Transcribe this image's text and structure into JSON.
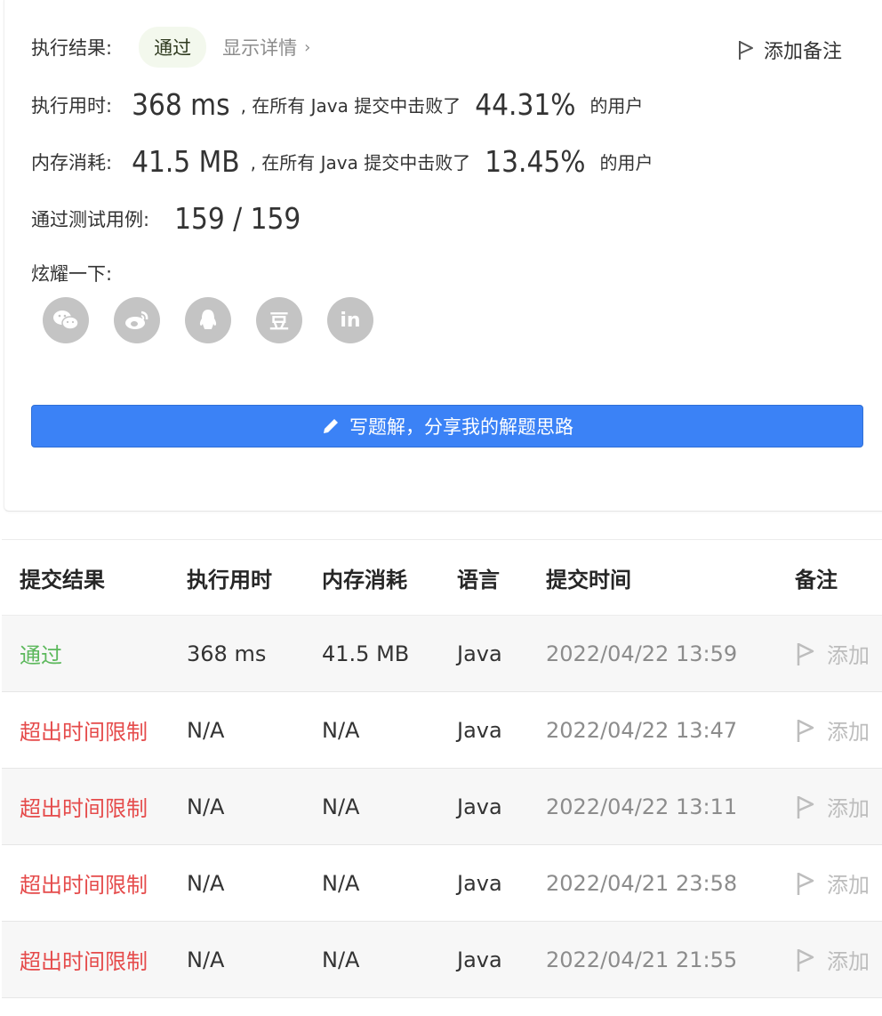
{
  "result": {
    "label": "执行结果:",
    "status": "通过",
    "detail": "显示详情",
    "add_note": "添加备注"
  },
  "runtime": {
    "label": "执行用时:",
    "value": "368 ms",
    "mid": ", 在所有 Java 提交中击败了",
    "percent": "44.31%",
    "suffix": "的用户"
  },
  "memory": {
    "label": "内存消耗:",
    "value": "41.5 MB",
    "mid": ", 在所有 Java 提交中击败了",
    "percent": "13.45%",
    "suffix": "的用户"
  },
  "tests": {
    "label": "通过测试用例:",
    "value": "159 / 159"
  },
  "share": {
    "label": "炫耀一下:",
    "icons": [
      "wechat-icon",
      "weibo-icon",
      "qq-icon",
      "douban-icon",
      "linkedin-icon"
    ],
    "douban_glyph": "豆",
    "linkedin_glyph": "in"
  },
  "write_button": "写题解，分享我的解题思路",
  "table": {
    "headers": [
      "提交结果",
      "执行用时",
      "内存消耗",
      "语言",
      "提交时间",
      "备注"
    ],
    "rows": [
      {
        "result": "通过",
        "time": "368 ms",
        "memory": "41.5 MB",
        "lang": "Java",
        "date": "2022/04/22 13:59",
        "note": "添加"
      },
      {
        "result": "超出时间限制",
        "time": "N/A",
        "memory": "N/A",
        "lang": "Java",
        "date": "2022/04/22 13:47",
        "note": "添加"
      },
      {
        "result": "超出时间限制",
        "time": "N/A",
        "memory": "N/A",
        "lang": "Java",
        "date": "2022/04/22 13:11",
        "note": "添加"
      },
      {
        "result": "超出时间限制",
        "time": "N/A",
        "memory": "N/A",
        "lang": "Java",
        "date": "2022/04/21 23:58",
        "note": "添加"
      },
      {
        "result": "超出时间限制",
        "time": "N/A",
        "memory": "N/A",
        "lang": "Java",
        "date": "2022/04/21 21:55",
        "note": "添加"
      }
    ]
  },
  "colors": {
    "accent": "#3b82f6",
    "pass": "#5cb85c",
    "fail": "#e54b4b"
  }
}
